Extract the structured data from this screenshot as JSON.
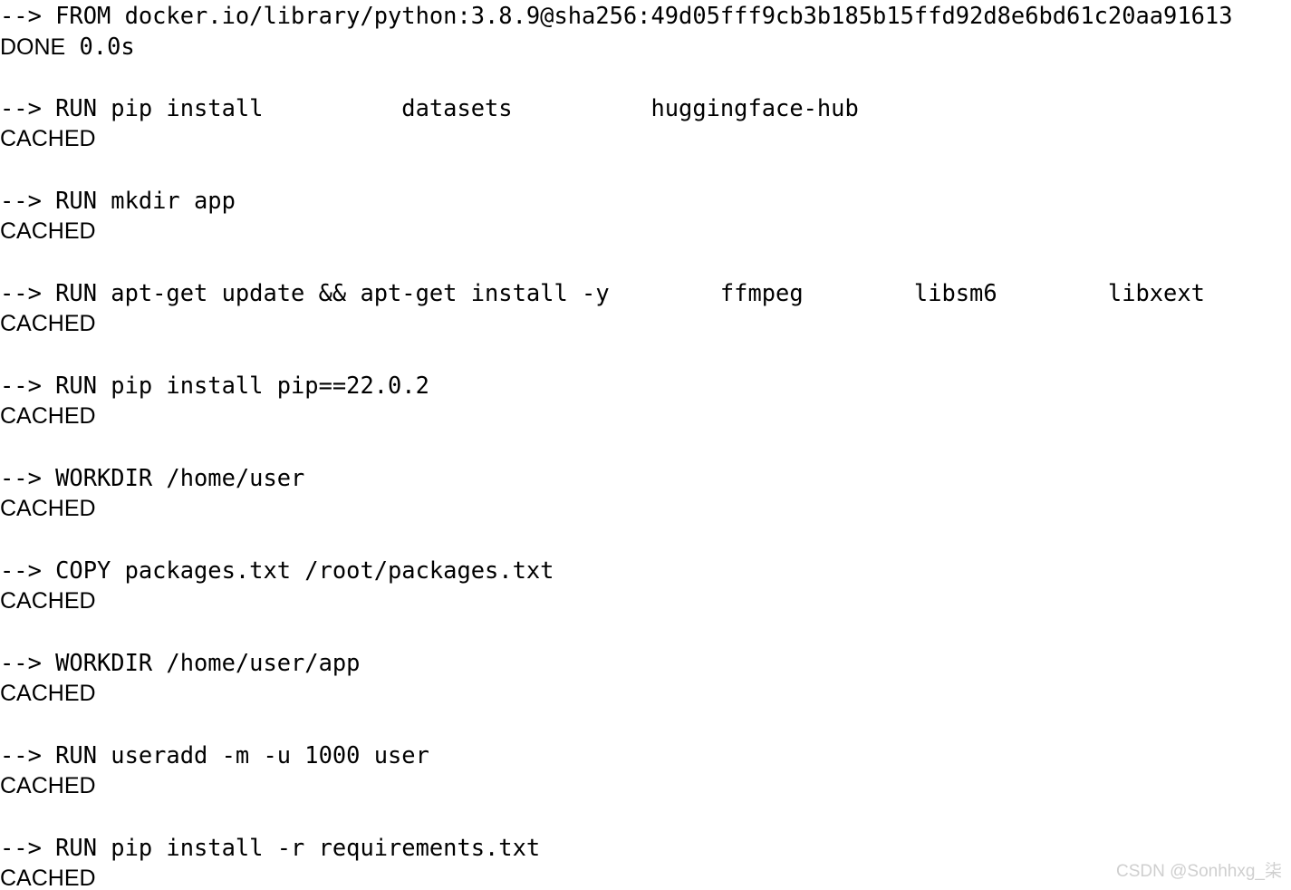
{
  "log": {
    "background_color": "#ffffff",
    "text_color": "#000000",
    "steps": [
      {
        "command": "--> FROM docker.io/library/python:3.8.9@sha256:49d05fff9cb3b185b15ffd92d8e6bd61c20aa91613",
        "status": "DONE",
        "elapsed": " 0.0s",
        "clipped_right": true
      },
      {
        "command": "--> RUN pip install          datasets          huggingface-hub",
        "status": "CACHED",
        "elapsed": "",
        "clipped_right": false
      },
      {
        "command": "--> RUN mkdir app",
        "status": "CACHED",
        "elapsed": "",
        "clipped_right": false
      },
      {
        "command": "--> RUN apt-get update && apt-get install -y        ffmpeg        libsm6        libxext",
        "status": "CACHED",
        "elapsed": "",
        "clipped_right": true
      },
      {
        "command": "--> RUN pip install pip==22.0.2",
        "status": "CACHED",
        "elapsed": "",
        "clipped_right": false
      },
      {
        "command": "--> WORKDIR /home/user",
        "status": "CACHED",
        "elapsed": "",
        "clipped_right": false
      },
      {
        "command": "--> COPY packages.txt /root/packages.txt",
        "status": "CACHED",
        "elapsed": "",
        "clipped_right": false
      },
      {
        "command": "--> WORKDIR /home/user/app",
        "status": "CACHED",
        "elapsed": "",
        "clipped_right": false
      },
      {
        "command": "--> RUN useradd -m -u 1000 user",
        "status": "CACHED",
        "elapsed": "",
        "clipped_right": false
      },
      {
        "command": "--> RUN pip install -r requirements.txt",
        "status": "CACHED",
        "elapsed": "",
        "clipped_right": false
      }
    ]
  },
  "watermark": {
    "text": "CSDN @Sonhhxg_柒",
    "color": "#cfcfcf"
  }
}
